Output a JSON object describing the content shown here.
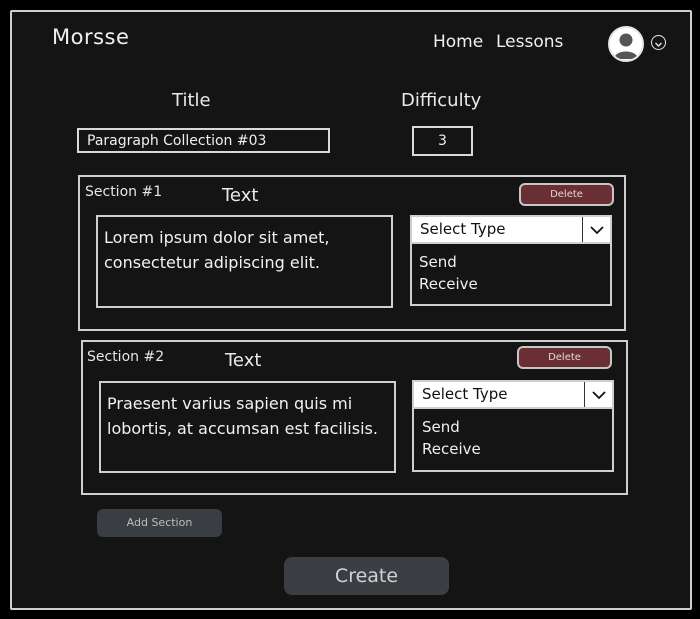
{
  "header": {
    "logo": "Morsse",
    "nav": {
      "home": "Home",
      "lessons": "Lessons"
    },
    "icons": {
      "avatar": "user-avatar-icon",
      "menu": "chevron-down-icon"
    }
  },
  "form": {
    "title_label": "Title",
    "title_value": "Paragraph Collection #03",
    "difficulty_label": "Difficulty",
    "difficulty_value": "3"
  },
  "sections": [
    {
      "number_label": "Section #1",
      "text_label": "Text",
      "delete_label": "Delete",
      "text": "Lorem ipsum dolor sit amet, consectetur adipiscing elit.",
      "select_placeholder": "Select Type",
      "options": [
        "Send",
        "Receive"
      ]
    },
    {
      "number_label": "Section #2",
      "text_label": "Text",
      "delete_label": "Delete",
      "text": "Praesent varius sapien quis mi lobortis, at accumsan est facilisis.",
      "select_placeholder": "Select Type",
      "options": [
        "Send",
        "Receive"
      ]
    }
  ],
  "actions": {
    "add_section": "Add Section",
    "create": "Create"
  },
  "colors": {
    "background": "#141414",
    "delete_button": "#6a2f33",
    "secondary_button": "#3a3d41"
  }
}
